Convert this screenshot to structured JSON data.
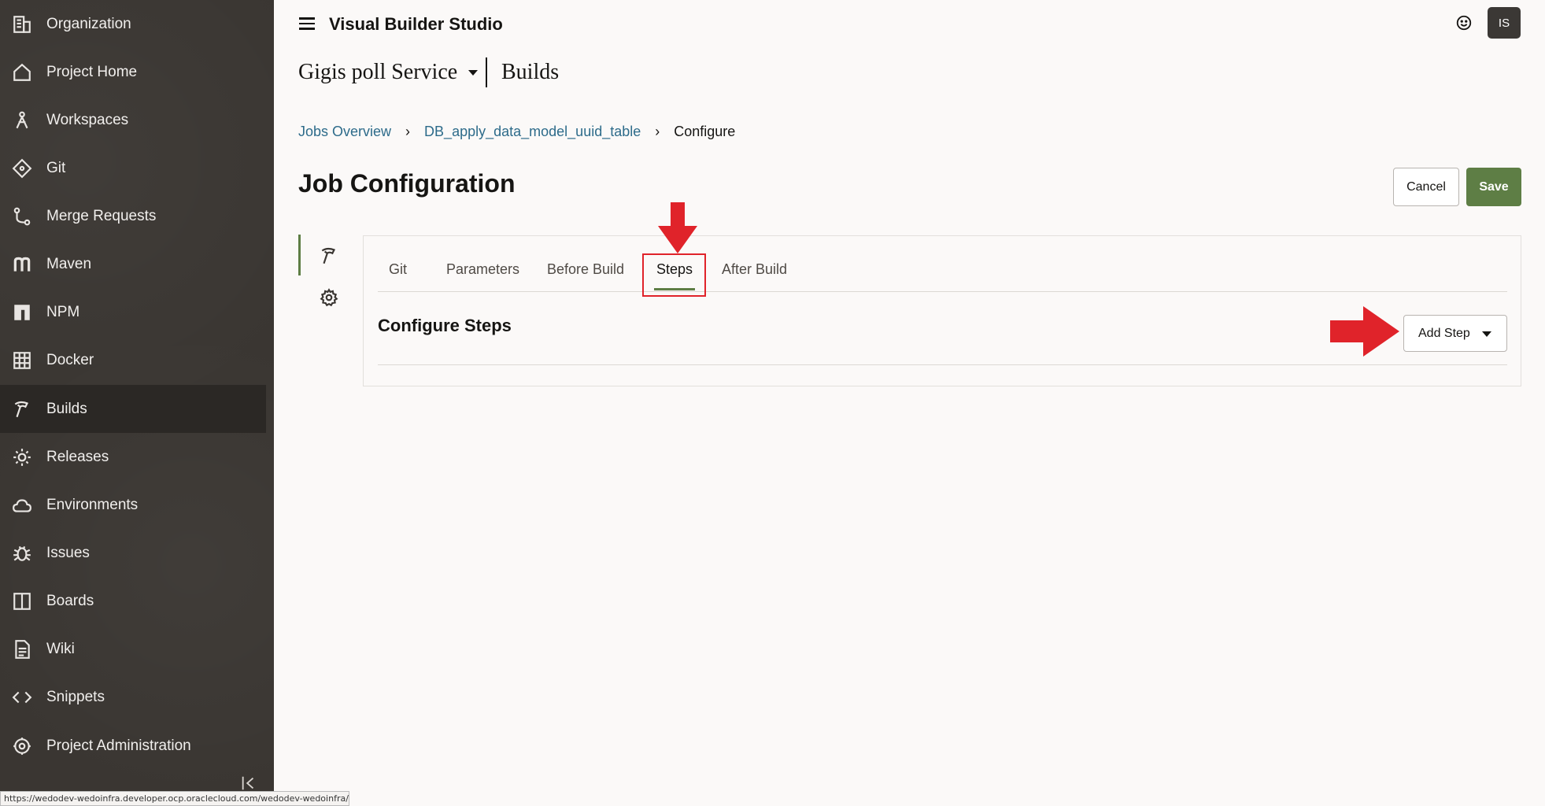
{
  "sidebar": {
    "items": [
      {
        "label": "Organization",
        "icon": "building-icon"
      },
      {
        "label": "Project Home",
        "icon": "home-icon"
      },
      {
        "label": "Workspaces",
        "icon": "workspace-icon"
      },
      {
        "label": "Git",
        "icon": "git-icon"
      },
      {
        "label": "Merge Requests",
        "icon": "merge-icon"
      },
      {
        "label": "Maven",
        "icon": "maven-icon"
      },
      {
        "label": "NPM",
        "icon": "npm-icon"
      },
      {
        "label": "Docker",
        "icon": "docker-icon"
      },
      {
        "label": "Builds",
        "icon": "hammer-icon",
        "active": true
      },
      {
        "label": "Releases",
        "icon": "gear-icon"
      },
      {
        "label": "Environments",
        "icon": "cloud-icon"
      },
      {
        "label": "Issues",
        "icon": "bug-icon"
      },
      {
        "label": "Boards",
        "icon": "board-icon"
      },
      {
        "label": "Wiki",
        "icon": "document-icon"
      },
      {
        "label": "Snippets",
        "icon": "code-icon"
      },
      {
        "label": "Project Administration",
        "icon": "settings-icon"
      }
    ]
  },
  "header": {
    "app_title": "Visual Builder Studio",
    "avatar_initials": "IS"
  },
  "project": {
    "name": "Gigis poll Service",
    "section": "Builds"
  },
  "breadcrumb": {
    "items": [
      "Jobs Overview",
      "DB_apply_data_model_uuid_table"
    ],
    "current": "Configure"
  },
  "page": {
    "title": "Job Configuration",
    "cancel_label": "Cancel",
    "save_label": "Save"
  },
  "tabs": [
    "Git",
    "Parameters",
    "Before Build",
    "Steps",
    "After Build"
  ],
  "active_tab": "Steps",
  "steps": {
    "title": "Configure Steps",
    "add_step_label": "Add Step"
  },
  "status_url": "https://wedodev-wedoinfra.developer.ocp.oraclecloud.com/wedodev-wedoinfra/#",
  "colors": {
    "sidebar_bg": "#3a3632",
    "accent_green": "#5e7e45",
    "link_blue": "#2d6b8a",
    "annotation_red": "#e0232a"
  }
}
